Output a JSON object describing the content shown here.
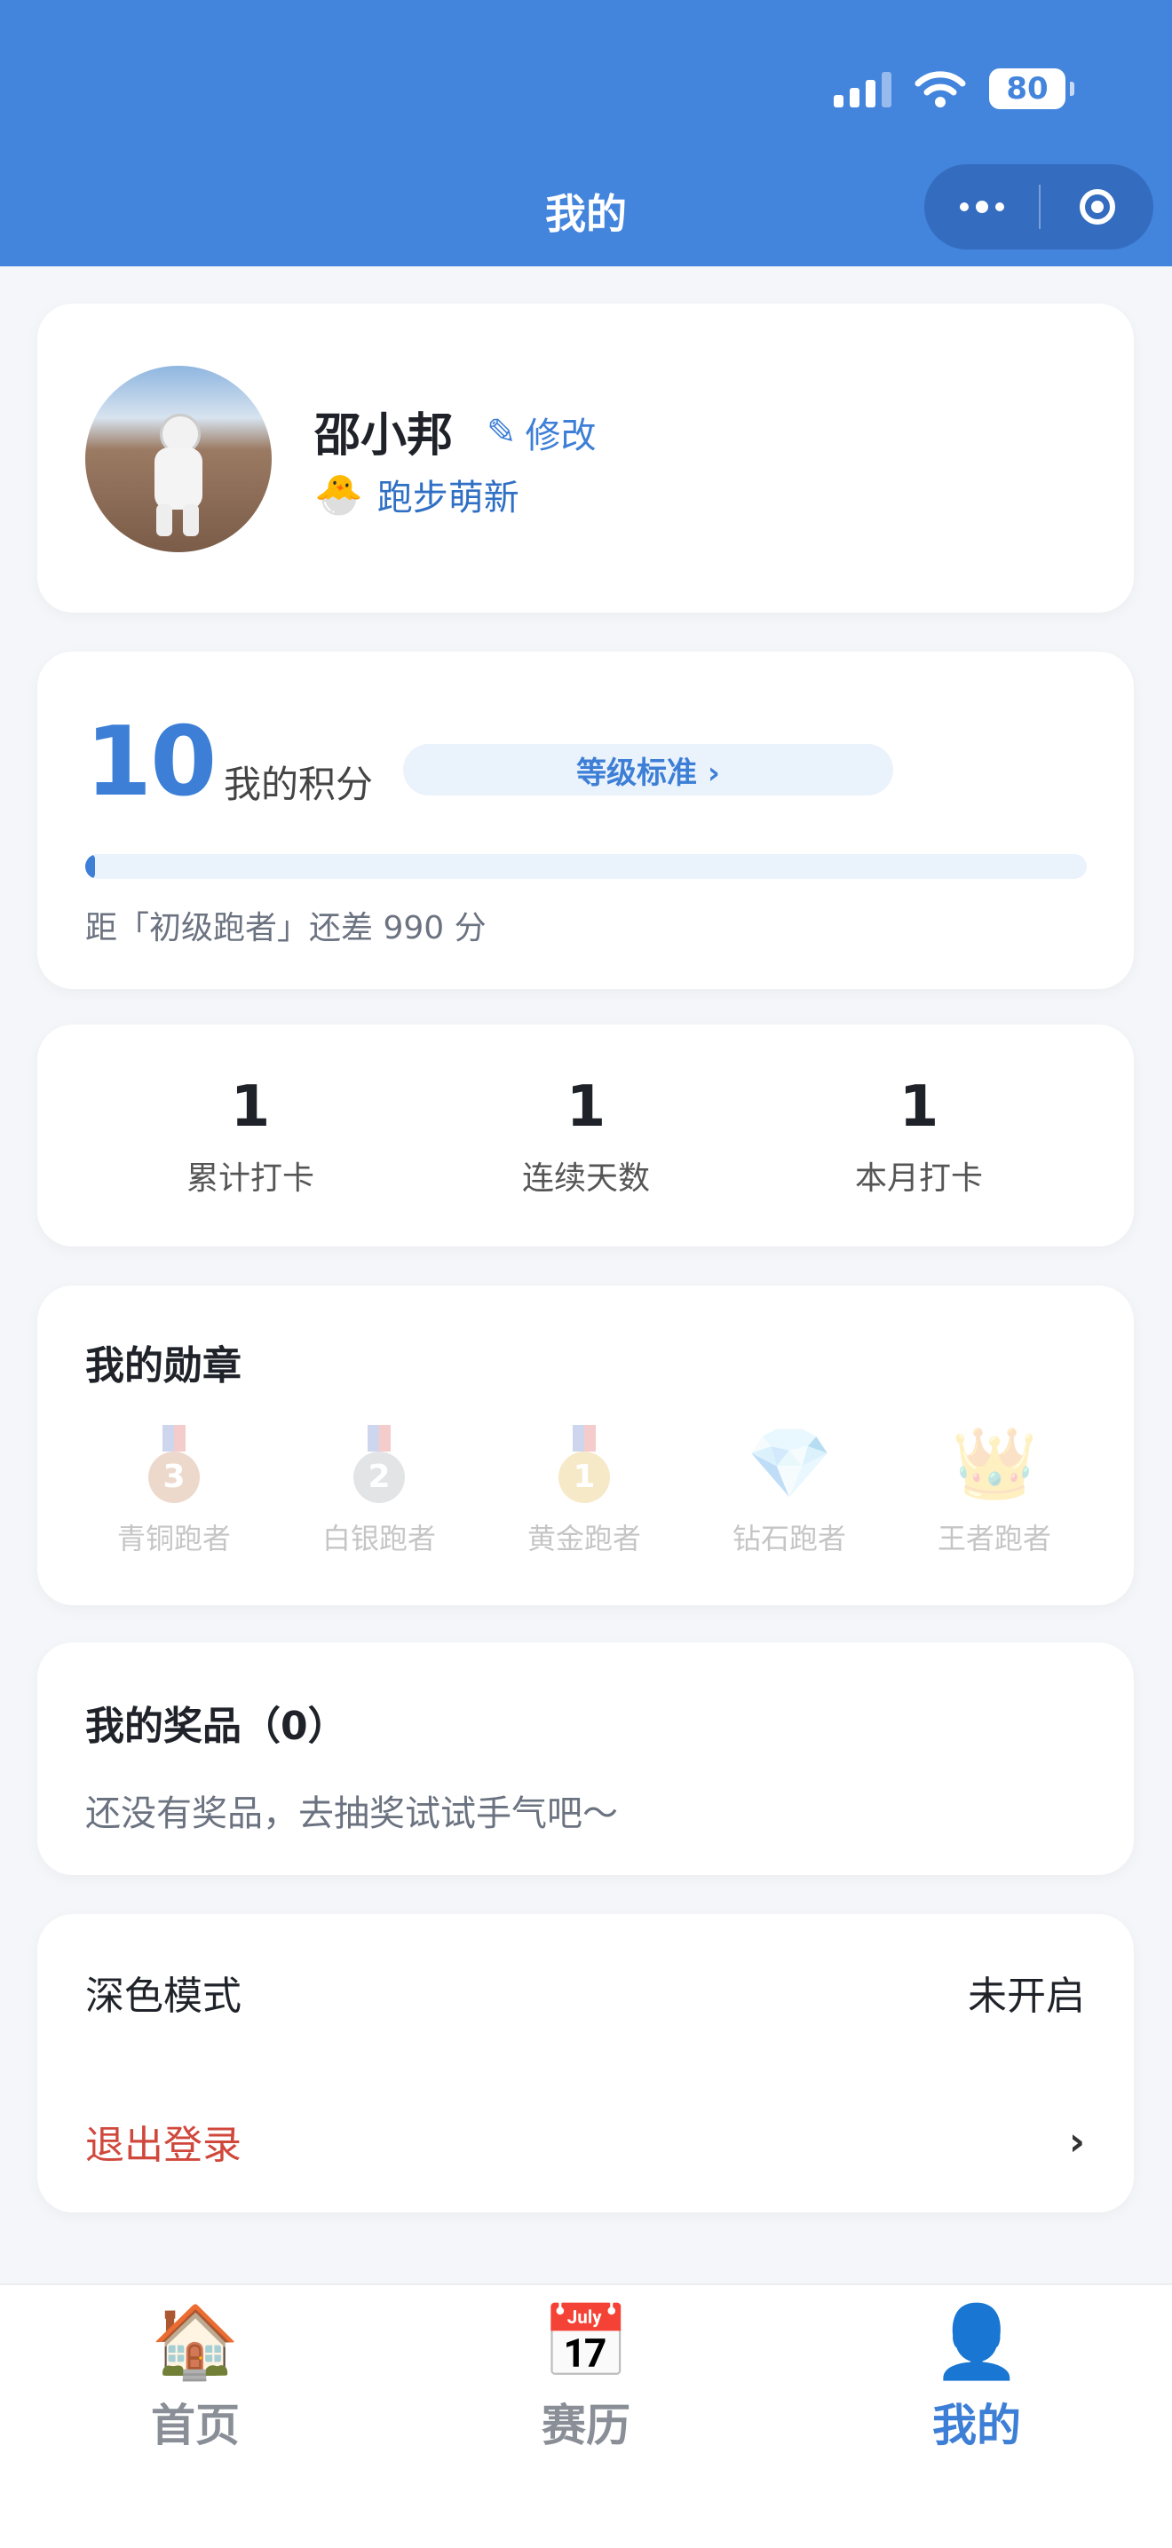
{
  "status_bar": {
    "battery": "80"
  },
  "nav": {
    "title": "我的",
    "more_icon": "more-dots-icon",
    "close_icon": "target-icon"
  },
  "profile": {
    "name": "邵小邦",
    "edit_label": "修改",
    "edit_icon": "pencil-icon",
    "level_icon": "hatching-chick-icon",
    "level": "跑步萌新"
  },
  "points": {
    "value": "10",
    "label": "我的积分",
    "level_standard": "等级标准 ›",
    "progress_fraction": 0.01,
    "progress_text": "距「初级跑者」还差 990 分"
  },
  "stats": [
    {
      "value": "1",
      "label": "累计打卡"
    },
    {
      "value": "1",
      "label": "连续天数"
    },
    {
      "value": "1",
      "label": "本月打卡"
    }
  ],
  "medals": {
    "title": "我的勋章",
    "items": [
      {
        "label": "青铜跑者",
        "icon": "bronze-medal-icon",
        "badge": "3",
        "color": "#c27a4a"
      },
      {
        "label": "白银跑者",
        "icon": "silver-medal-icon",
        "badge": "2",
        "color": "#9aa1a8"
      },
      {
        "label": "黄金跑者",
        "icon": "gold-medal-icon",
        "badge": "1",
        "color": "#e2b23a"
      },
      {
        "label": "钻石跑者",
        "icon": "diamond-icon"
      },
      {
        "label": "王者跑者",
        "icon": "crown-icon"
      }
    ]
  },
  "prizes": {
    "title": "我的奖品（0）",
    "empty_text": "还没有奖品，去抽奖试试手气吧～"
  },
  "settings": {
    "dark_mode_label": "深色模式",
    "dark_mode_value": "未开启",
    "logout_label": "退出登录",
    "chevron": "›"
  },
  "tabs": [
    {
      "label": "首页",
      "icon": "house-icon",
      "active": false
    },
    {
      "label": "赛历",
      "icon": "calendar-icon",
      "active": false
    },
    {
      "label": "我的",
      "icon": "user-icon",
      "active": true
    }
  ],
  "colors": {
    "primary": "#4384dc",
    "accent": "#3d7fd6",
    "danger": "#d0473b"
  }
}
